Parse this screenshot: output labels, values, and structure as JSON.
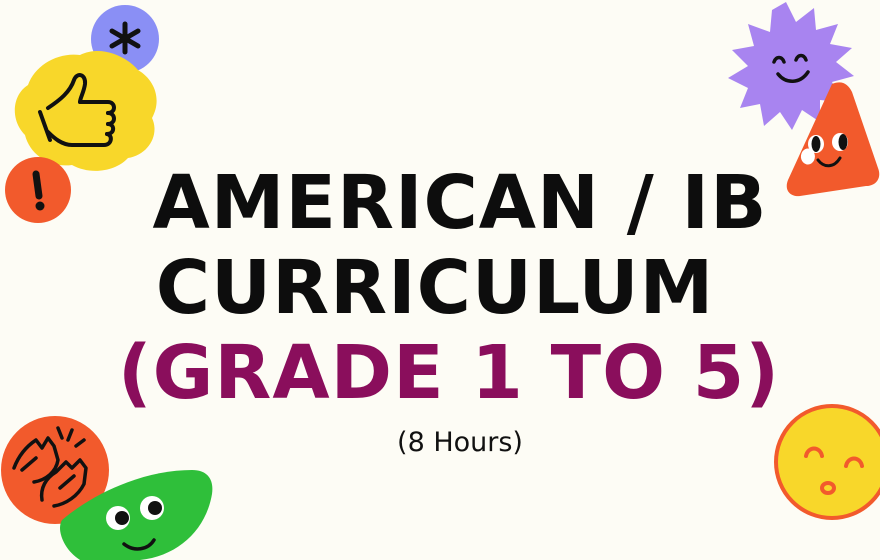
{
  "title": {
    "line1": "AMERICAN / IB",
    "line2": "CURRICULUM",
    "line3": "(GRADE 1 TO 5)"
  },
  "subtitle": "(8 Hours)",
  "colors": {
    "background": "#fdfcf5",
    "title_dark": "#0d0d0d",
    "title_accent": "#8a0e5c",
    "sticker_yellow": "#f8d72a",
    "sticker_blue": "#8a8ff5",
    "sticker_orange": "#f25a2c",
    "sticker_purple": "#a884f0",
    "sticker_green": "#2fbf3a"
  },
  "icons": [
    "asterisk-icon",
    "thumbs-up-icon",
    "exclamation-icon",
    "smiling-star-icon",
    "triangle-face-icon",
    "clapping-hands-icon",
    "green-face-icon",
    "sun-face-icon"
  ]
}
